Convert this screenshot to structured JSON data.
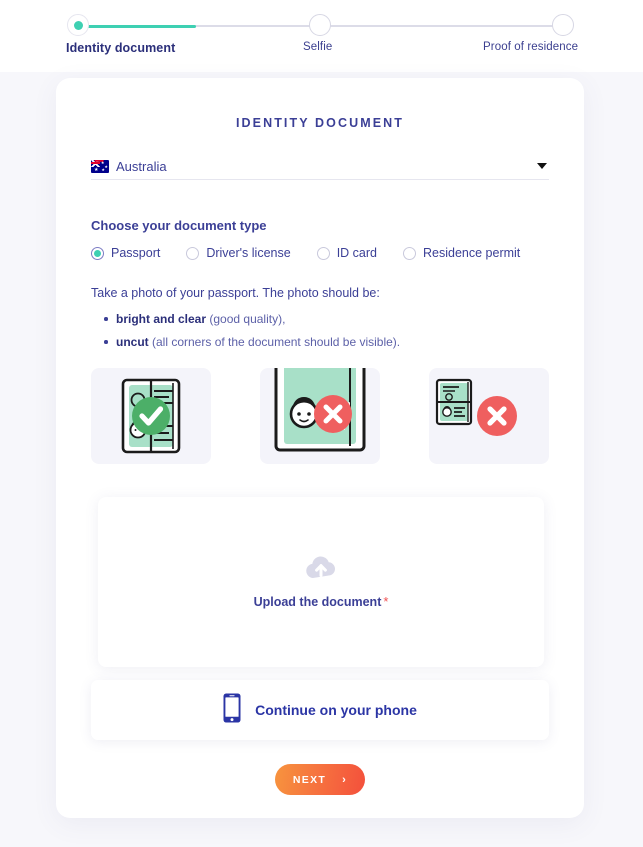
{
  "stepper": {
    "steps": [
      {
        "label": "Identity document",
        "state": "active"
      },
      {
        "label": "Selfie",
        "state": "pending"
      },
      {
        "label": "Proof of residence",
        "state": "pending"
      }
    ],
    "active_color": "#3ed0b2",
    "track_color": "#dcdce8"
  },
  "card": {
    "title": "IDENTITY DOCUMENT",
    "country": {
      "icon": "flag-australia-icon",
      "value": "Australia",
      "arrow_icon": "chevron-down-icon"
    },
    "doc_type": {
      "heading": "Choose your document type",
      "options": [
        {
          "label": "Passport",
          "selected": true
        },
        {
          "label": "Driver's license",
          "selected": false
        },
        {
          "label": "ID card",
          "selected": false
        },
        {
          "label": "Residence permit",
          "selected": false
        }
      ],
      "selected_color": "#3ed0b2"
    },
    "instructions": {
      "lead": "Take a photo of your passport. The photo should be:",
      "bullets": [
        {
          "bold": "bright and clear",
          "rest": " (good quality),"
        },
        {
          "bold": "uncut",
          "rest": " (all corners of the document should be visible)."
        }
      ]
    },
    "examples": [
      {
        "name": "example-good-passport",
        "status": "good",
        "badge_icon": "check-circle-icon",
        "badge_color": "#4caf68"
      },
      {
        "name": "example-cut-passport",
        "status": "bad",
        "badge_icon": "x-circle-icon",
        "badge_color": "#ef5f5f"
      },
      {
        "name": "example-too-small-passport",
        "status": "bad",
        "badge_icon": "x-circle-icon",
        "badge_color": "#ef5f5f"
      }
    ],
    "upload": {
      "icon": "cloud-upload-icon",
      "label": "Upload the document",
      "required_marker": "*",
      "required_color": "#f05252"
    },
    "phone": {
      "icon": "mobile-phone-icon",
      "label": "Continue on your phone"
    },
    "next": {
      "label": "NEXT",
      "chevron": "›",
      "gradient_from": "#f7943e",
      "gradient_to": "#f4503c"
    }
  }
}
